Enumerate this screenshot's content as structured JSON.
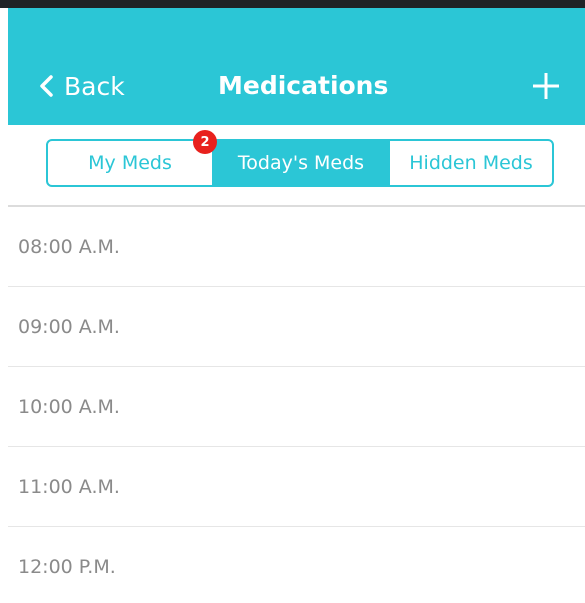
{
  "header": {
    "back_label": "Back",
    "title": "Medications",
    "add_icon": "plus-icon",
    "back_icon": "chevron-left-icon"
  },
  "tabs": {
    "items": [
      {
        "label": "My Meds",
        "selected": false
      },
      {
        "label": "Today's Meds",
        "selected": true
      },
      {
        "label": "Hidden Meds",
        "selected": false
      }
    ],
    "badge_count": "2"
  },
  "schedule": {
    "times": [
      "08:00 A.M.",
      "09:00 A.M.",
      "10:00 A.M.",
      "11:00 A.M.",
      "12:00 P.M."
    ]
  },
  "colors": {
    "accent": "#2bc6d6",
    "badge": "#e8211d",
    "text_muted": "#8a8a8a"
  }
}
